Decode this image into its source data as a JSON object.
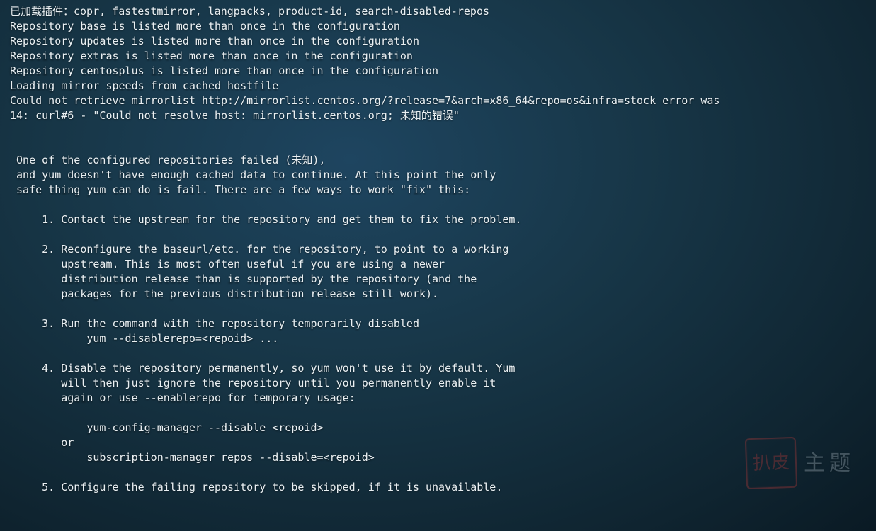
{
  "lines": [
    "已加载插件：copr, fastestmirror, langpacks, product-id, search-disabled-repos",
    "Repository base is listed more than once in the configuration",
    "Repository updates is listed more than once in the configuration",
    "Repository extras is listed more than once in the configuration",
    "Repository centosplus is listed more than once in the configuration",
    "Loading mirror speeds from cached hostfile",
    "Could not retrieve mirrorlist http://mirrorlist.centos.org/?release=7&arch=x86_64&repo=os&infra=stock error was",
    "14: curl#6 - \"Could not resolve host: mirrorlist.centos.org; 未知的错误\"",
    "",
    "",
    " One of the configured repositories failed (未知),",
    " and yum doesn't have enough cached data to continue. At this point the only",
    " safe thing yum can do is fail. There are a few ways to work \"fix\" this:",
    "",
    "     1. Contact the upstream for the repository and get them to fix the problem.",
    "",
    "     2. Reconfigure the baseurl/etc. for the repository, to point to a working",
    "        upstream. This is most often useful if you are using a newer",
    "        distribution release than is supported by the repository (and the",
    "        packages for the previous distribution release still work).",
    "",
    "     3. Run the command with the repository temporarily disabled",
    "            yum --disablerepo=<repoid> ...",
    "",
    "     4. Disable the repository permanently, so yum won't use it by default. Yum",
    "        will then just ignore the repository until you permanently enable it",
    "        again or use --enablerepo for temporary usage:",
    "",
    "            yum-config-manager --disable <repoid>",
    "        or",
    "            subscription-manager repos --disable=<repoid>",
    "",
    "     5. Configure the failing repository to be skipped, if it is unavailable."
  ],
  "watermark": {
    "stamp": "扒皮",
    "text": "主题"
  }
}
